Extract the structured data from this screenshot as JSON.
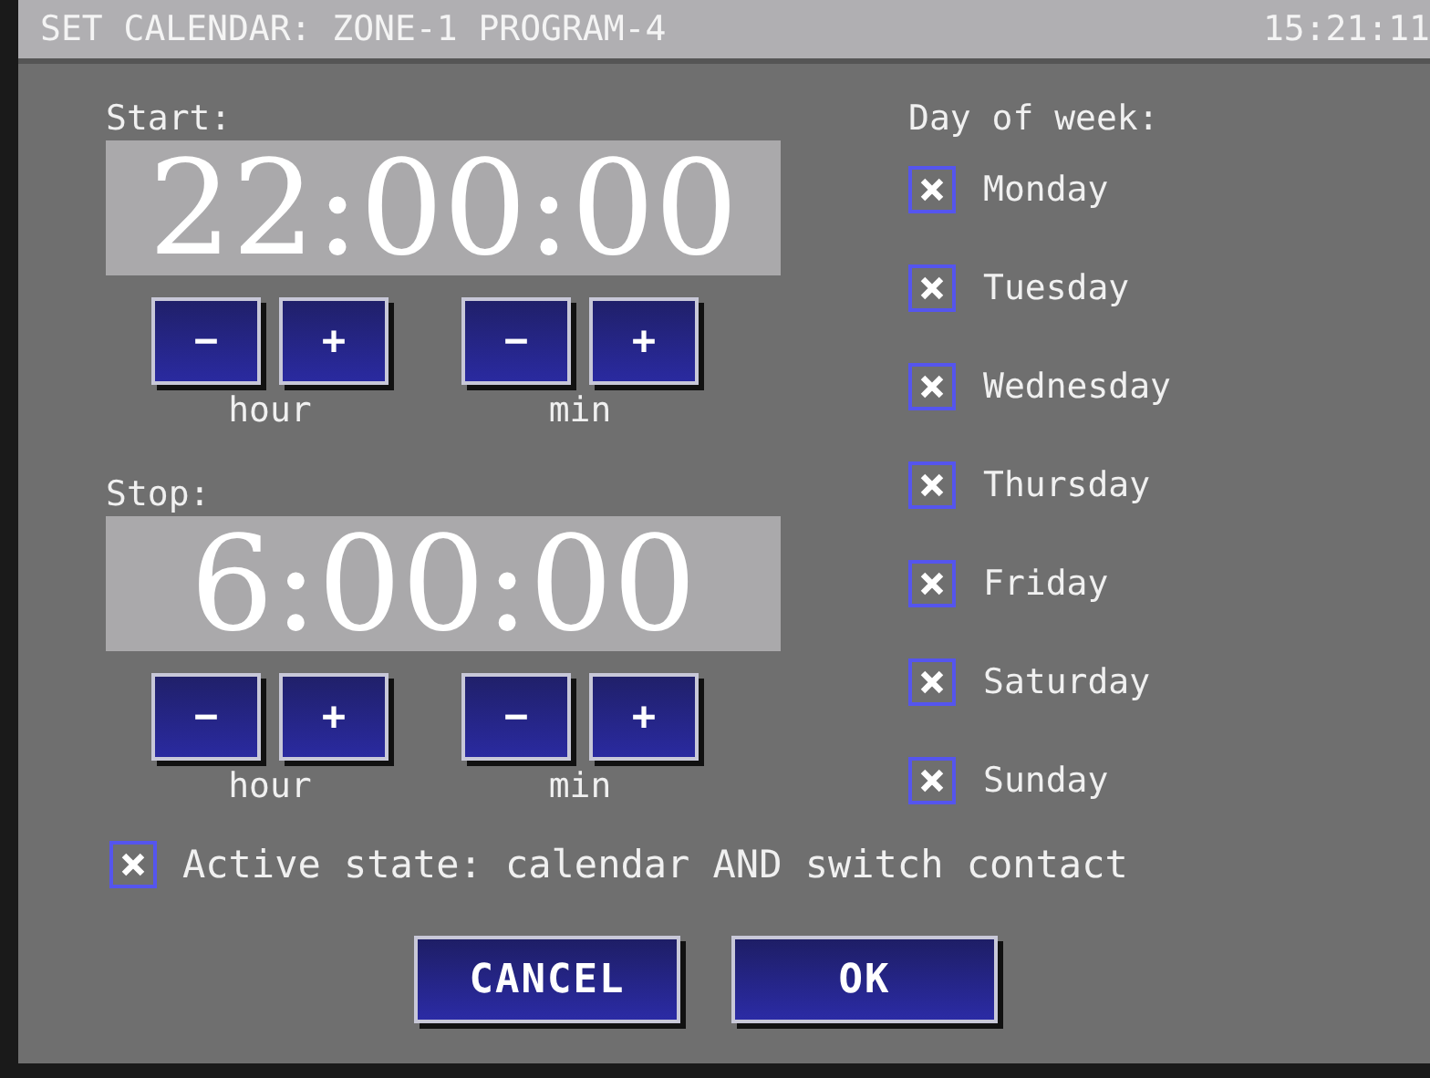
{
  "window": {
    "title": "SET CALENDAR: ZONE-1 PROGRAM-4",
    "clock": "15:21:11"
  },
  "times": [
    {
      "label": "Start:",
      "value": "22:00:00",
      "controls": [
        {
          "unit": "hour",
          "buttons": [
            "−",
            "+"
          ]
        },
        {
          "unit": "min",
          "buttons": [
            "−",
            "+"
          ]
        }
      ]
    },
    {
      "label": "Stop:",
      "value": "6:00:00",
      "controls": [
        {
          "unit": "hour",
          "buttons": [
            "−",
            "+"
          ]
        },
        {
          "unit": "min",
          "buttons": [
            "−",
            "+"
          ]
        }
      ]
    }
  ],
  "days": {
    "label": "Day of week:",
    "items": [
      {
        "label": "Monday",
        "checked": true
      },
      {
        "label": "Tuesday",
        "checked": true
      },
      {
        "label": "Wednesday",
        "checked": true
      },
      {
        "label": "Thursday",
        "checked": true
      },
      {
        "label": "Friday",
        "checked": true
      },
      {
        "label": "Saturday",
        "checked": true
      },
      {
        "label": "Sunday",
        "checked": true
      }
    ]
  },
  "active_state": {
    "label": "Active state: calendar AND switch contact",
    "checked": true
  },
  "buttons": [
    "CANCEL",
    "OK"
  ]
}
